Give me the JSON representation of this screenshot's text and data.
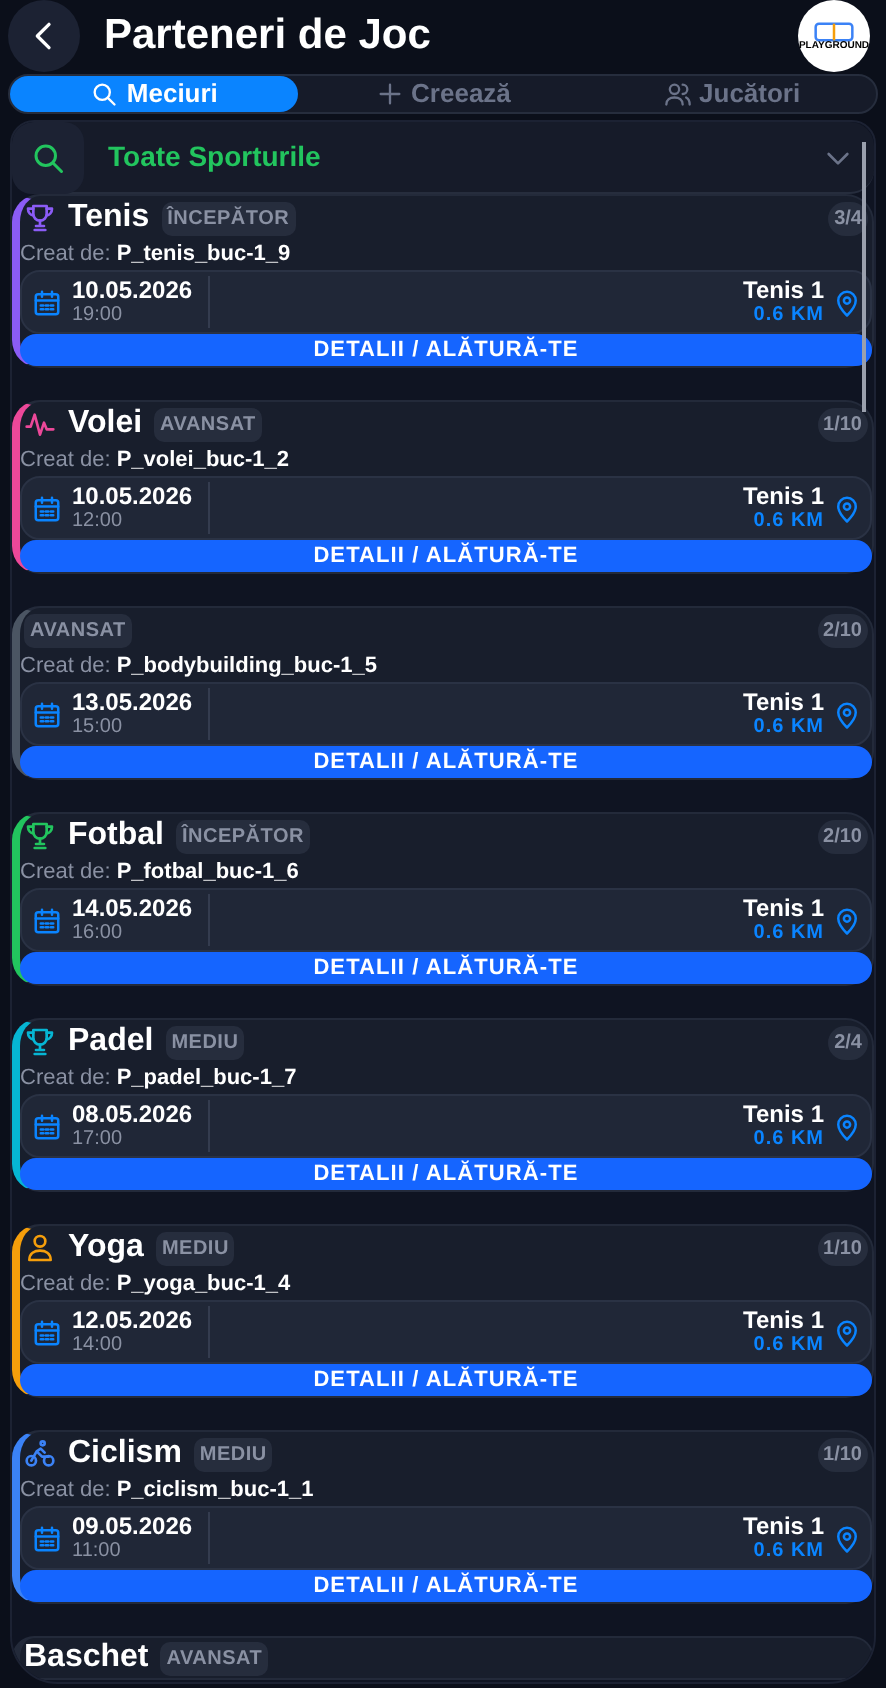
{
  "header": {
    "title": "Parteneri de Joc",
    "logo_text": "PLAYGROUND"
  },
  "tabs": [
    {
      "label": "Meciuri",
      "kind": "search",
      "selected": true
    },
    {
      "label": "Creează",
      "kind": "plus",
      "selected": false
    },
    {
      "label": "Jucători",
      "kind": "users",
      "selected": false
    }
  ],
  "filter": {
    "value": "Toate Sporturile"
  },
  "matches": [
    {
      "sport": "Tenis",
      "kind": "trophy",
      "color": "#8b5cf6",
      "level_label": "ÎNCEPĂTOR",
      "count": "3/4",
      "created_label": "Creat de:",
      "creator": "P_tenis_buc-1_9",
      "date": "10.05.2026",
      "time": "19:00",
      "venue": "Tenis 1",
      "distance": "0.6 KM",
      "action": "DETALII / ALĂTURĂ-TE"
    },
    {
      "sport": "Volei",
      "kind": "pulse",
      "color": "#ec4899",
      "level_label": "AVANSAT",
      "count": "1/10",
      "created_label": "Creat de:",
      "creator": "P_volei_buc-1_2",
      "date": "10.05.2026",
      "time": "12:00",
      "venue": "Tenis 1",
      "distance": "0.6 KM",
      "action": "DETALII / ALĂTURĂ-TE"
    },
    {
      "kind": "none",
      "color": "#4b5563",
      "level_label": "AVANSAT",
      "count": "2/10",
      "created_label": "Creat de:",
      "creator": "P_bodybuilding_buc-1_5",
      "date": "13.05.2026",
      "time": "15:00",
      "venue": "Tenis 1",
      "distance": "0.6 KM",
      "action": "DETALII / ALĂTURĂ-TE"
    },
    {
      "sport": "Fotbal",
      "kind": "trophy",
      "color": "#22c55e",
      "level_label": "ÎNCEPĂTOR",
      "count": "2/10",
      "created_label": "Creat de:",
      "creator": "P_fotbal_buc-1_6",
      "date": "14.05.2026",
      "time": "16:00",
      "venue": "Tenis 1",
      "distance": "0.6 KM",
      "action": "DETALII / ALĂTURĂ-TE"
    },
    {
      "sport": "Padel",
      "kind": "trophy",
      "color": "#06b6d4",
      "level_label": "MEDIU",
      "count": "2/4",
      "created_label": "Creat de:",
      "creator": "P_padel_buc-1_7",
      "date": "08.05.2026",
      "time": "17:00",
      "venue": "Tenis 1",
      "distance": "0.6 KM",
      "action": "DETALII / ALĂTURĂ-TE"
    },
    {
      "sport": "Yoga",
      "kind": "person",
      "color": "#f59e0b",
      "level_label": "MEDIU",
      "count": "1/10",
      "created_label": "Creat de:",
      "creator": "P_yoga_buc-1_4",
      "date": "12.05.2026",
      "time": "14:00",
      "venue": "Tenis 1",
      "distance": "0.6 KM",
      "action": "DETALII / ALĂTURĂ-TE"
    },
    {
      "sport": "Ciclism",
      "kind": "bike",
      "color": "#3b82f6",
      "level_label": "MEDIU",
      "count": "1/10",
      "created_label": "Creat de:",
      "creator": "P_ciclism_buc-1_1",
      "date": "09.05.2026",
      "time": "11:00",
      "venue": "Tenis 1",
      "distance": "0.6 KM",
      "action": "DETALII / ALĂTURĂ-TE"
    },
    {
      "sport": "Baschet",
      "kind": "none",
      "level_label": "AVANSAT"
    }
  ]
}
